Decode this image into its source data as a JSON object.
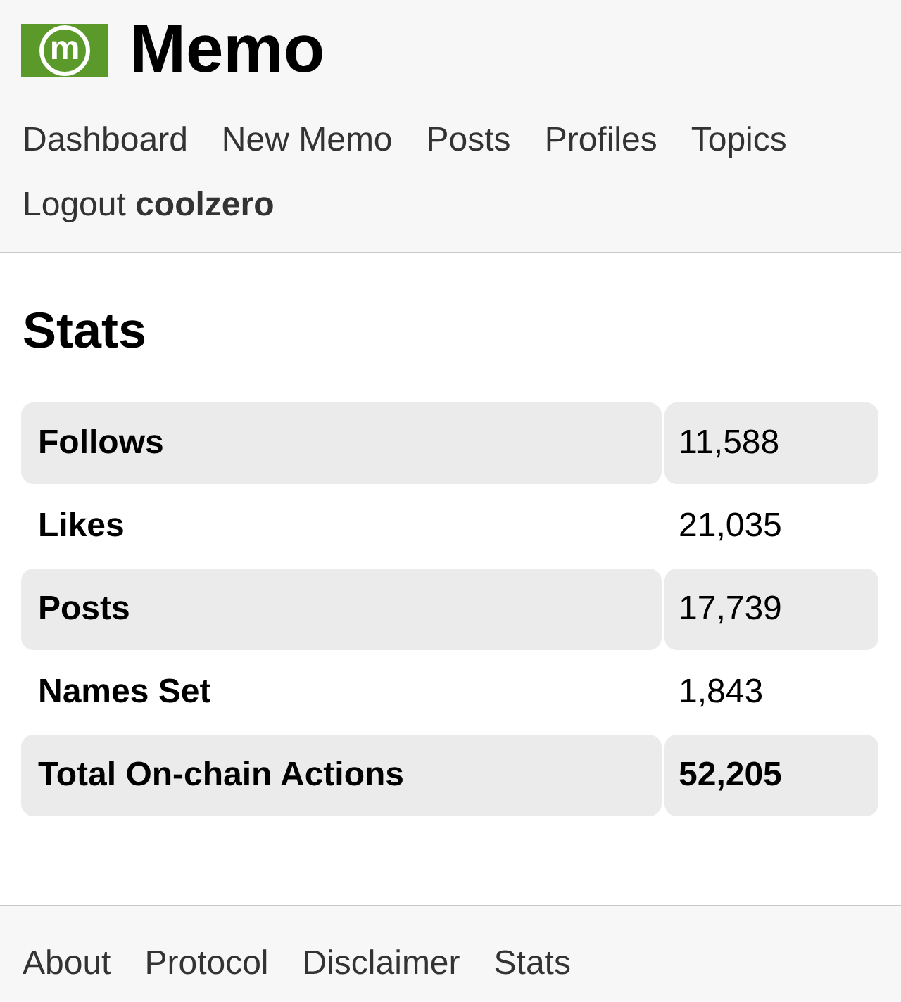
{
  "header": {
    "logo": {
      "letter": "m"
    },
    "title": "Memo",
    "nav": [
      "Dashboard",
      "New Memo",
      "Posts",
      "Profiles",
      "Topics",
      "Logout **coolzero**"
    ]
  },
  "main": {
    "heading": "Stats"
  },
  "stats_table": {
    "rows": [
      {
        "kind": "stat",
        "label": "Follows",
        "value": "11,588"
      },
      {
        "kind": "stat",
        "label": "Likes",
        "value": "21,035"
      },
      {
        "kind": "stat",
        "label": "Posts",
        "value": "17,739"
      },
      {
        "kind": "stat",
        "label": "Names Set",
        "value": "1,843"
      },
      {
        "kind": "total",
        "label": "Total On-chain Actions",
        "value": "52,205"
      }
    ]
  },
  "footer": {
    "links": [
      "About",
      "Protocol",
      "Disclaimer",
      "Stats"
    ]
  }
}
